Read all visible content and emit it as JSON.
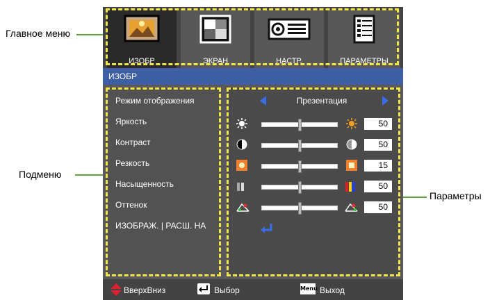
{
  "callouts": {
    "main_menu": "Главное меню",
    "submenu": "Подменю",
    "parameters": "Параметры"
  },
  "tabs": [
    {
      "label": "ИЗОБР",
      "icon": "picture-icon",
      "active": true
    },
    {
      "label": "ЭКРАН",
      "icon": "screen-icon",
      "active": false
    },
    {
      "label": "НАСТР.",
      "icon": "projector-icon",
      "active": false
    },
    {
      "label": "ПАРАМЕТРЫ",
      "icon": "options-icon",
      "active": false
    }
  ],
  "section_title": "ИЗОБР",
  "menu_items": [
    "Режим отображения",
    "Яркость",
    "Контраст",
    "Резкость",
    "Насыщенность",
    "Оттенок",
    "ИЗОБРАЖ. | РАСШ. НА"
  ],
  "display_mode": "Презентация",
  "sliders": [
    {
      "name": "brightness",
      "value": "50",
      "icon_left": "sun-icon",
      "icon_right": "sun-bright-icon"
    },
    {
      "name": "contrast",
      "value": "50",
      "icon_left": "contrast-icon",
      "icon_right": "contrast-icon"
    },
    {
      "name": "sharpness",
      "value": "15",
      "icon_left": "sharpness-icon",
      "icon_right": "sharpness-icon"
    },
    {
      "name": "saturation",
      "value": "50",
      "icon_left": "saturation-icon",
      "icon_right": "saturation-color-icon"
    },
    {
      "name": "tint",
      "value": "50",
      "icon_left": "tint-icon",
      "icon_right": "tint-icon"
    }
  ],
  "footer": {
    "updown": "ВверхВниз",
    "select": "Выбор",
    "menu_key": "Menu",
    "exit": "Выход"
  },
  "colors": {
    "highlight": "#f4e64a",
    "title_bar": "#3f5fa4",
    "callout_line": "#5fa33a",
    "arrow_blue": "#3a6ee8"
  }
}
